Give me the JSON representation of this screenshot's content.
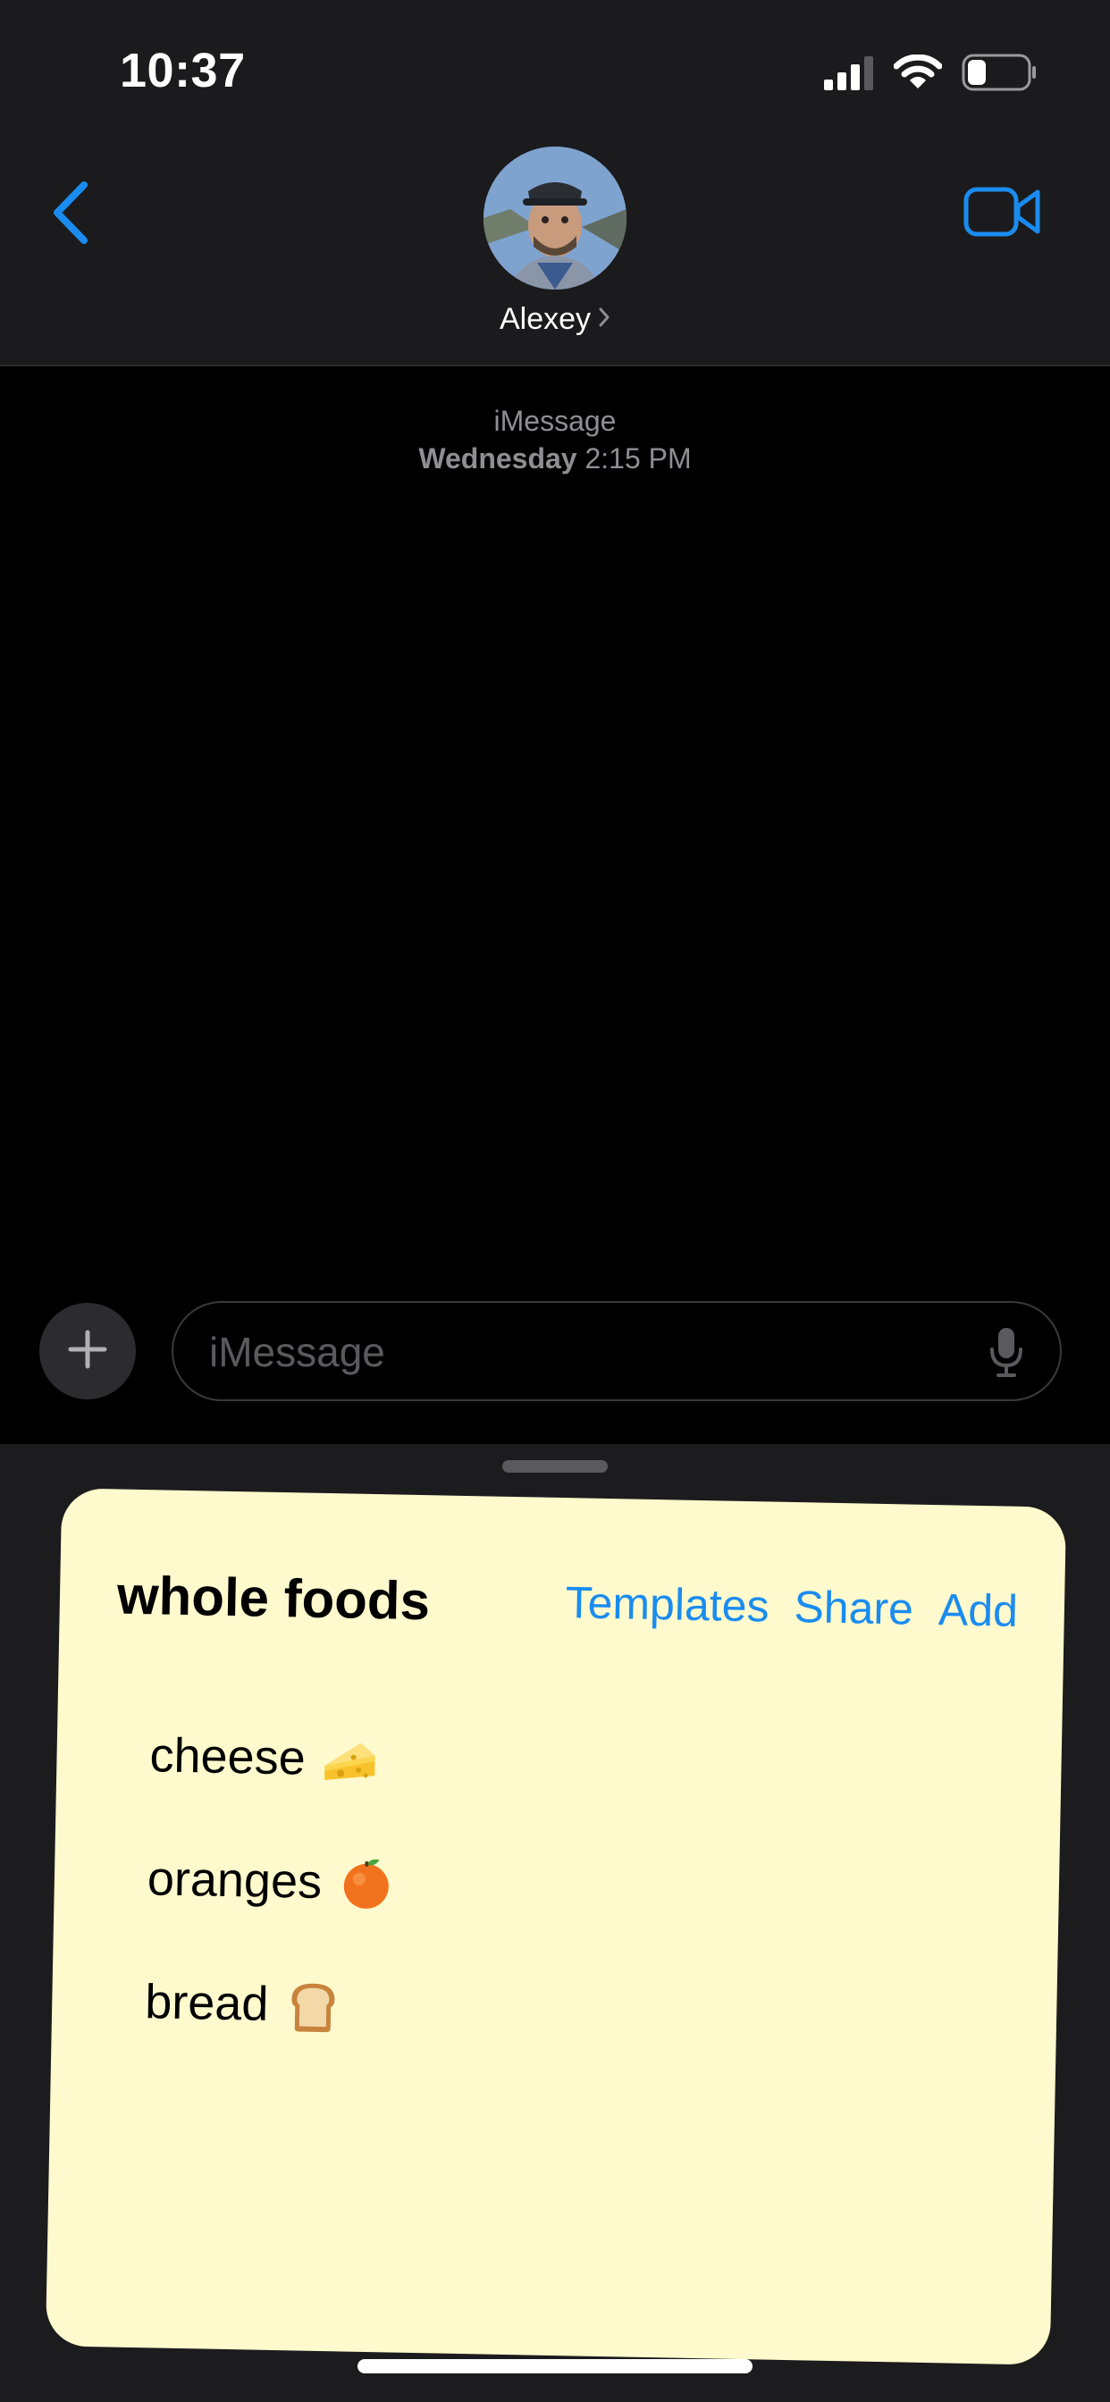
{
  "status_bar": {
    "time": "10:37",
    "icons": [
      "cellular-signal-icon",
      "wifi-icon",
      "battery-icon"
    ]
  },
  "header": {
    "back_icon": "chevron-left-icon",
    "contact_name": "Alexey",
    "video_icon": "video-camera-icon",
    "accent_color": "#1a8cf0"
  },
  "conversation": {
    "service": "iMessage",
    "day": "Wednesday",
    "time": "2:15 PM"
  },
  "compose": {
    "plus_icon": "plus-icon",
    "placeholder": "iMessage",
    "mic_icon": "microphone-icon"
  },
  "note": {
    "title": "whole foods",
    "actions": {
      "templates": "Templates",
      "share": "Share",
      "add": "Add"
    },
    "items": [
      {
        "label": "cheese",
        "emoji": "cheese-icon"
      },
      {
        "label": "oranges",
        "emoji": "orange-icon"
      },
      {
        "label": "bread",
        "emoji": "bread-icon"
      }
    ],
    "background_color": "#fffacd"
  }
}
